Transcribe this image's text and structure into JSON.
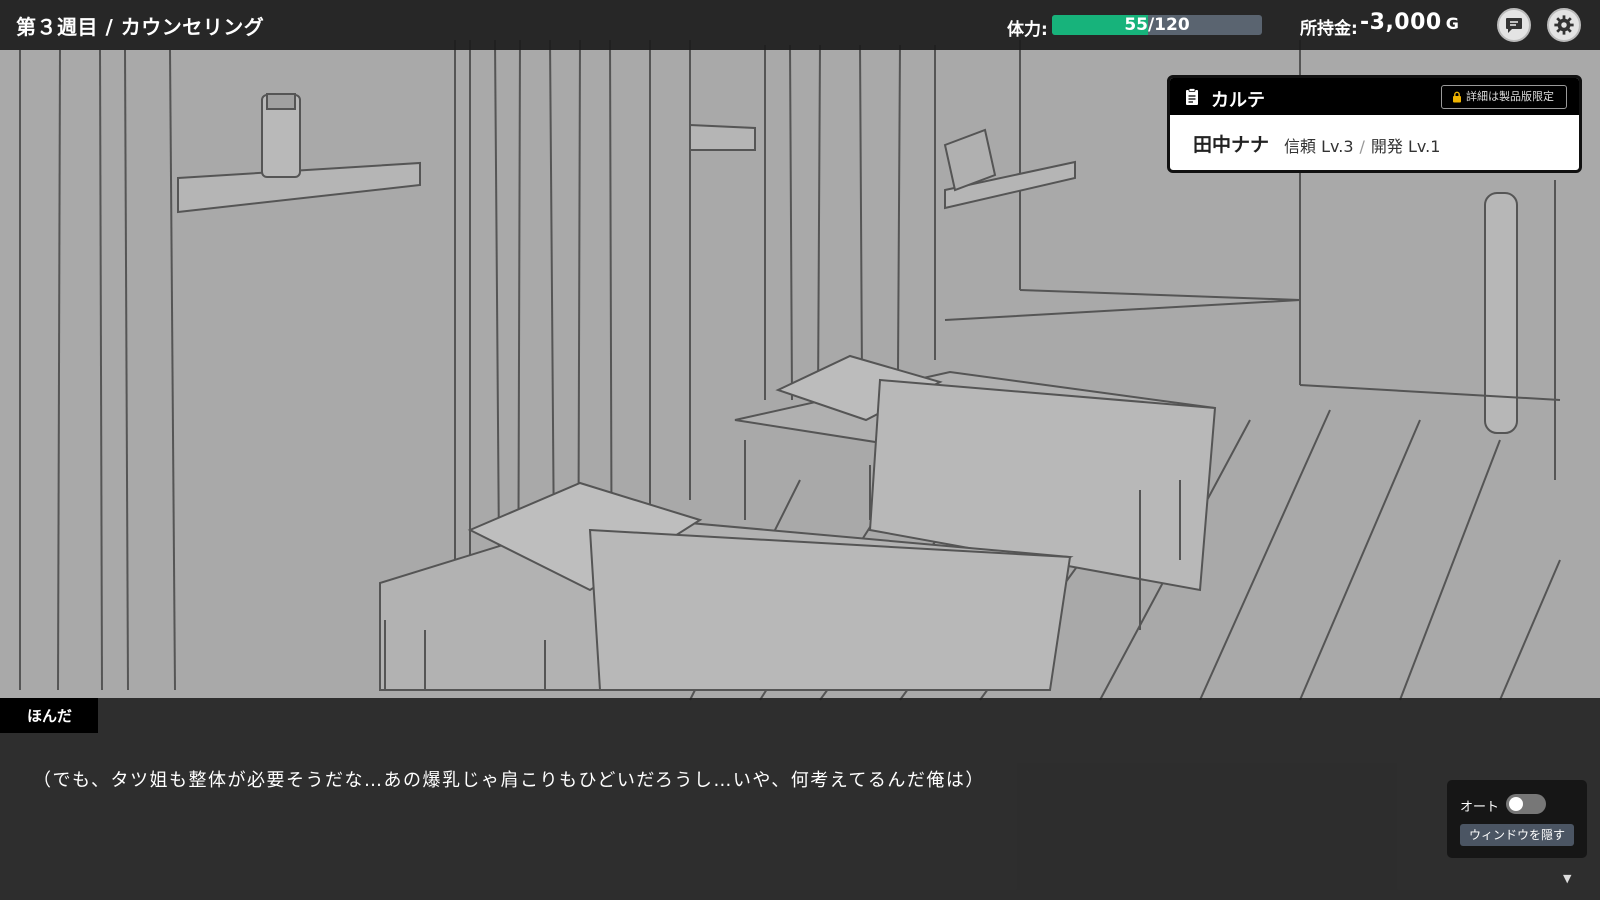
{
  "header": {
    "chapter_title": "第３週目 / カウンセリング",
    "stamina_label": "体力:",
    "stamina_current": 55,
    "stamina_max": 120,
    "stamina_text": "55/120",
    "money_label": "所持金:",
    "money_value": "-3,000",
    "money_unit": "G"
  },
  "karte": {
    "title": "カルテ",
    "lock_button_label": "詳細は製品版限定",
    "patient_name": "田中ナナ",
    "trust": "信頼 Lv.3",
    "separator": "/",
    "development": "開発 Lv.1"
  },
  "dialogue": {
    "speaker": "ほんだ",
    "text": "（でも、タツ姐も整体が必要そうだな…あの爆乳じゃ肩こりもひどいだろうし…いや、何考えてるんだ俺は）"
  },
  "controls": {
    "auto_label": "オート",
    "auto_enabled": false,
    "hide_window_label": "ウィンドウを隠す",
    "next_indicator": "▼"
  },
  "icons": {
    "log": "chat-bubble-icon",
    "settings": "gear-icon",
    "karte": "document-icon",
    "lock": "lock-icon"
  },
  "colors": {
    "stamina_fill": "#17b37b",
    "stamina_track": "#5a6470",
    "hide_button": "#4b5563"
  }
}
